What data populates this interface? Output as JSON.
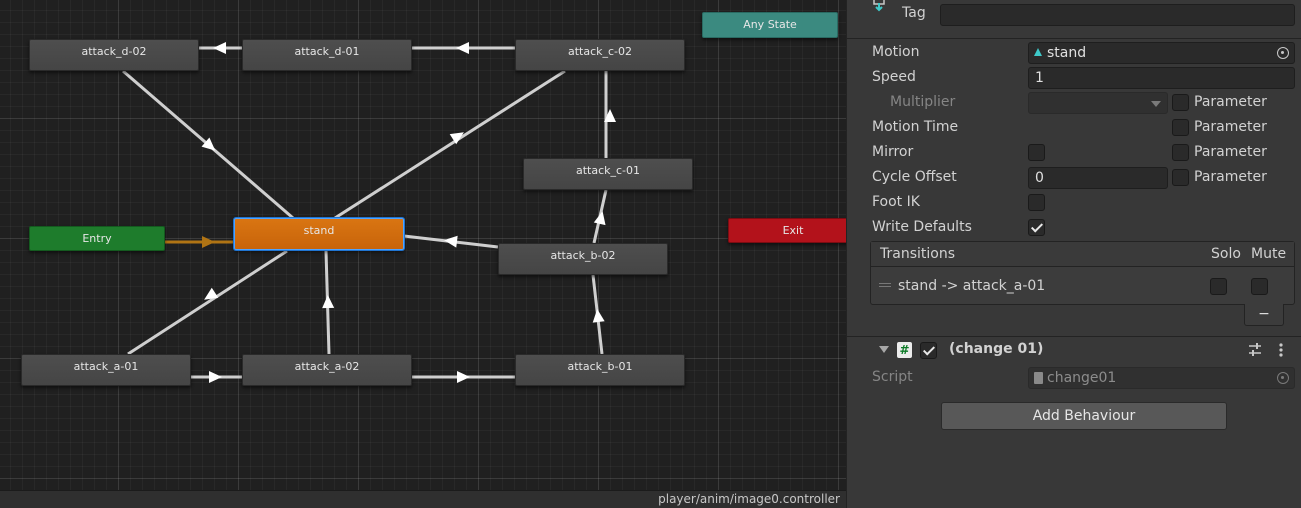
{
  "graph": {
    "nodes": {
      "any_state": "Any State",
      "attack_d_02": "attack_d-02",
      "attack_d_01": "attack_d-01",
      "attack_c_02": "attack_c-02",
      "attack_c_01": "attack_c-01",
      "entry": "Entry",
      "stand": "stand",
      "attack_b_02": "attack_b-02",
      "exit": "Exit",
      "attack_a_01": "attack_a-01",
      "attack_a_02": "attack_a-02",
      "attack_b_01": "attack_b-01"
    },
    "controller_path": "player/anim/image0.controller"
  },
  "inspector": {
    "tag_label": "Tag",
    "tag_value": "",
    "motion_label": "Motion",
    "motion_value": "stand",
    "speed_label": "Speed",
    "speed_value": "1",
    "multiplier_label": "Multiplier",
    "motion_time_label": "Motion Time",
    "mirror_label": "Mirror",
    "cycle_offset_label": "Cycle Offset",
    "cycle_offset_value": "0",
    "foot_ik_label": "Foot IK",
    "write_defaults_label": "Write Defaults",
    "parameter_label": "Parameter",
    "transitions": {
      "header": "Transitions",
      "solo": "Solo",
      "mute": "Mute",
      "items": [
        "stand -> attack_a-01"
      ],
      "remove": "−"
    },
    "behaviour": {
      "title": "(change 01)",
      "script_label": "Script",
      "script_value": "change01",
      "add_button": "Add Behaviour"
    }
  },
  "colors": {
    "selected_state": "#d97512",
    "entry_state": "#1e7c2c",
    "exit_state": "#b3121b",
    "any_state": "#3b8a80",
    "selection_outline": "#4fa3ff"
  }
}
